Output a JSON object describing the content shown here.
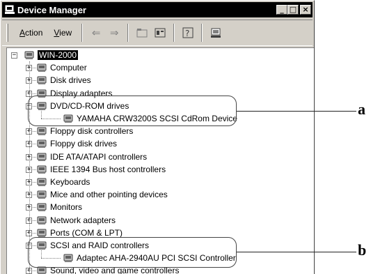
{
  "window": {
    "title": "Device Manager",
    "caption_buttons": {
      "minimize": "_",
      "maximize": "□",
      "close": "×"
    }
  },
  "menubar": {
    "action": {
      "prefix": "",
      "underline": "A",
      "rest": "ction"
    },
    "view": {
      "prefix": "",
      "underline": "V",
      "rest": "iew"
    }
  },
  "toolbar": {
    "buttons": [
      "back-icon",
      "forward-icon",
      "folder-up-icon",
      "properties-icon",
      "help-icon",
      "scan-hardware-icon"
    ]
  },
  "tree": {
    "root": "WIN-2000",
    "categories": [
      {
        "label": "Computer",
        "expanded": false,
        "icon": "computer-icon"
      },
      {
        "label": "Disk drives",
        "expanded": false,
        "icon": "disk-drive-icon"
      },
      {
        "label": "Display adapters",
        "expanded": false,
        "icon": "display-adapter-icon"
      },
      {
        "label": "DVD/CD-ROM drives",
        "expanded": true,
        "icon": "cdrom-icon",
        "children": [
          {
            "label": "YAMAHA CRW3200S SCSI CdRom Device",
            "icon": "cdrom-device-icon"
          }
        ]
      },
      {
        "label": "Floppy disk controllers",
        "expanded": false,
        "icon": "floppy-controller-icon"
      },
      {
        "label": "Floppy disk drives",
        "expanded": false,
        "icon": "floppy-drive-icon"
      },
      {
        "label": "IDE ATA/ATAPI controllers",
        "expanded": false,
        "icon": "ide-controller-icon"
      },
      {
        "label": "IEEE 1394 Bus host controllers",
        "expanded": false,
        "icon": "ieee1394-icon"
      },
      {
        "label": "Keyboards",
        "expanded": false,
        "icon": "keyboard-icon"
      },
      {
        "label": "Mice and other pointing devices",
        "expanded": false,
        "icon": "mouse-icon"
      },
      {
        "label": "Monitors",
        "expanded": false,
        "icon": "monitor-icon"
      },
      {
        "label": "Network adapters",
        "expanded": false,
        "icon": "network-adapter-icon"
      },
      {
        "label": "Ports (COM & LPT)",
        "expanded": false,
        "icon": "port-icon"
      },
      {
        "label": "SCSI and RAID controllers",
        "expanded": true,
        "icon": "scsi-icon",
        "children": [
          {
            "label": "Adaptec AHA-2940AU PCI SCSI Controller",
            "icon": "scsi-controller-icon"
          }
        ]
      },
      {
        "label": "Sound, video and game controllers",
        "expanded": false,
        "icon": "sound-icon"
      }
    ]
  },
  "annotations": {
    "a": "a",
    "b": "b"
  },
  "colors": {
    "window_face": "#d4d0c8",
    "titlebar": "#000000",
    "selection": "#000000",
    "tree_background": "#ffffff"
  }
}
